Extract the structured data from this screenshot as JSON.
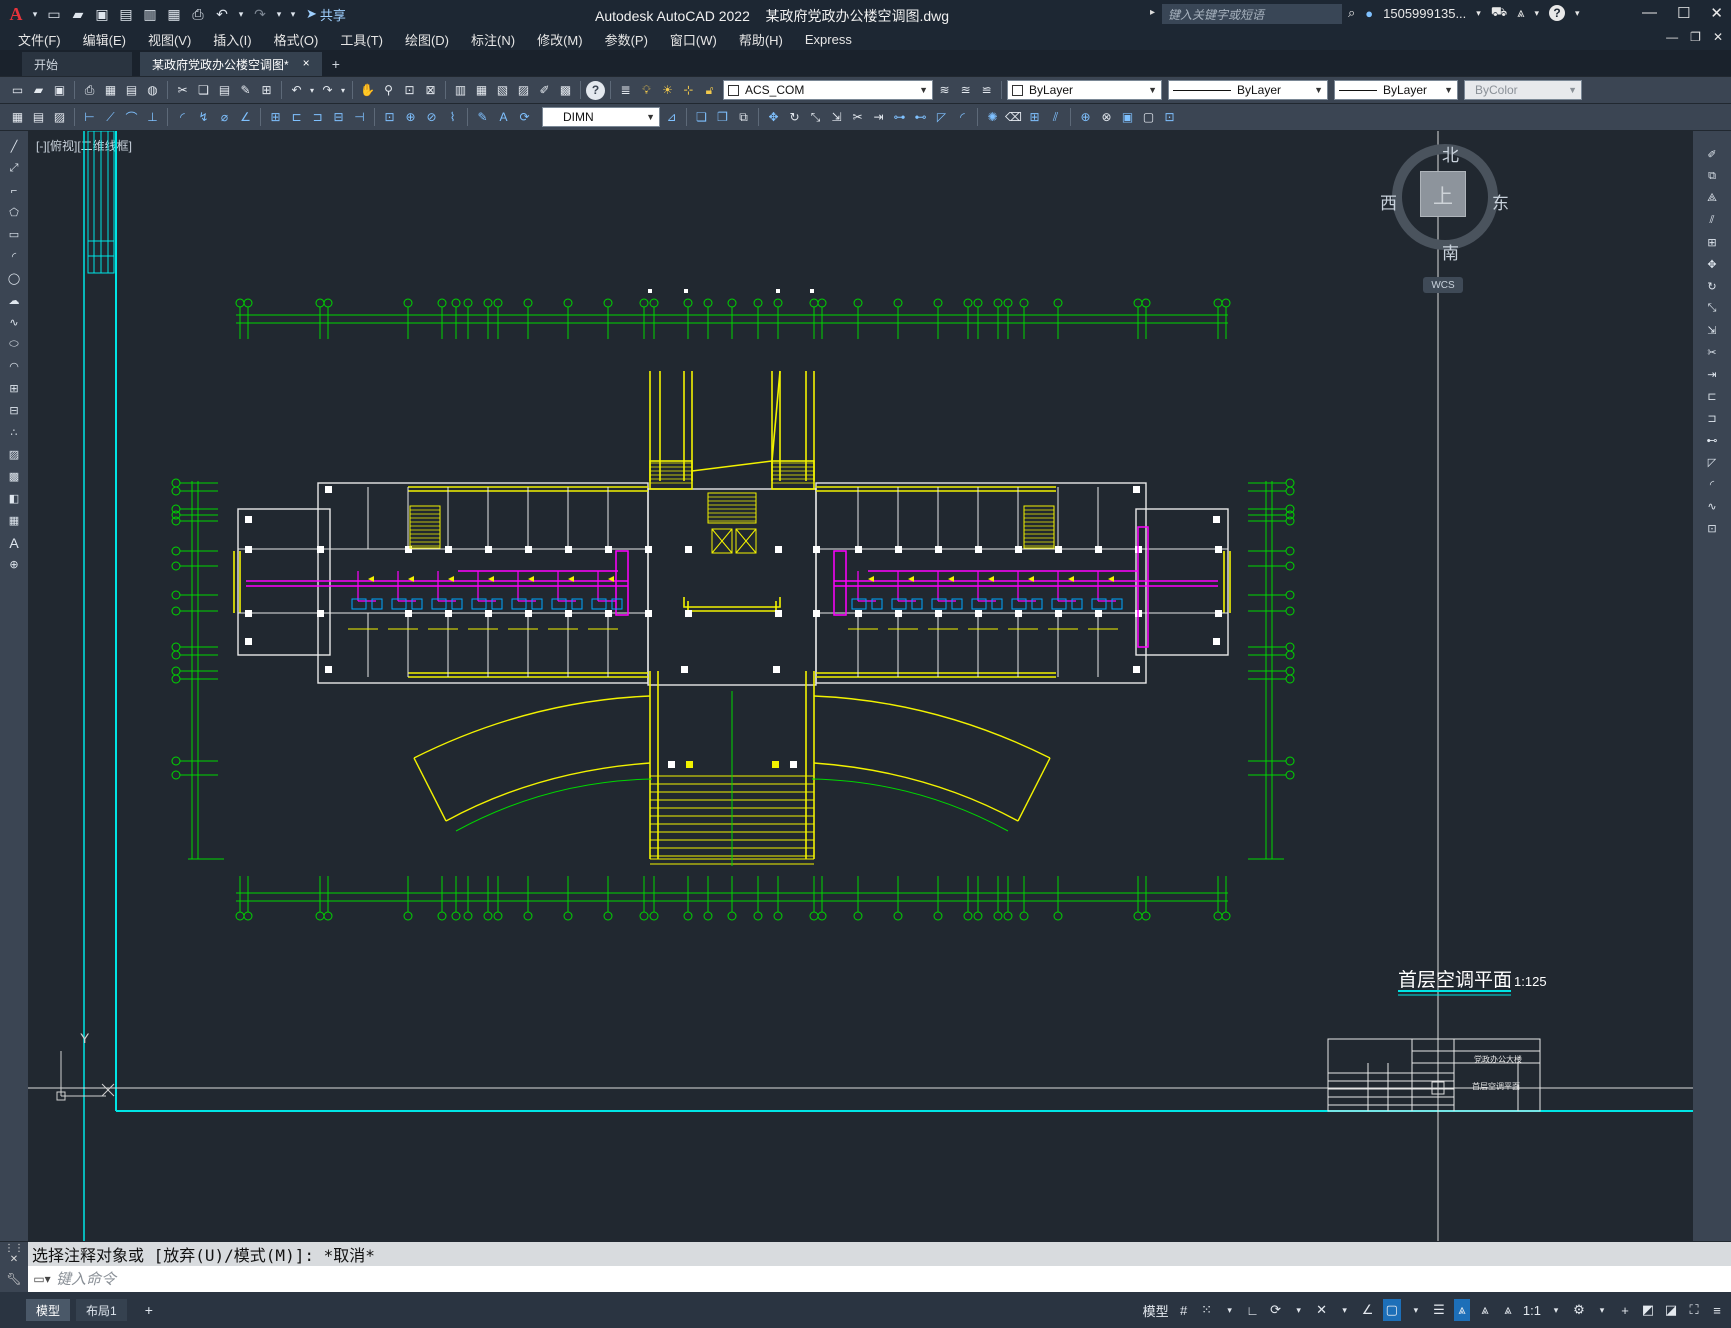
{
  "titlebar": {
    "app_name": "Autodesk AutoCAD 2022",
    "file_name": "某政府党政办公楼空调图.dwg",
    "share_label": "共享",
    "search_placeholder": "键入关键字或短语",
    "user": "1505999135...",
    "help_label": "?"
  },
  "menu": {
    "items": [
      "文件(F)",
      "编辑(E)",
      "视图(V)",
      "插入(I)",
      "格式(O)",
      "工具(T)",
      "绘图(D)",
      "标注(N)",
      "修改(M)",
      "参数(P)",
      "窗口(W)",
      "帮助(H)",
      "Express"
    ]
  },
  "tabs": {
    "start": "开始",
    "active": "某政府党政办公楼空调图*",
    "close": "×",
    "add": "+"
  },
  "toolbar": {
    "layer": "ACS_COM",
    "color": "ByLayer",
    "linetype": "ByLayer",
    "lineweight": "ByLayer",
    "plotstyle": "ByColor",
    "dimstyle": "DIMN"
  },
  "canvas": {
    "view_label": "[-][俯视][二维线框]",
    "viewcube": {
      "north": "北",
      "south": "南",
      "east": "东",
      "west": "西",
      "face": "上",
      "wcs": "WCS"
    },
    "plan_title": "首层空调平面",
    "plan_scale": "1:125",
    "ucs_y": "Y"
  },
  "titleblock": {
    "project": "党政办公大楼",
    "drawing": "首层空调平面"
  },
  "command": {
    "history": "选择注释对象或 [放弃(U)/模式(M)]: *取消*",
    "placeholder": "键入命令"
  },
  "statusbar": {
    "model_tab": "模型",
    "layout_tab": "布局1",
    "add": "+",
    "model_space": "模型",
    "scale": "1:1"
  },
  "colors": {
    "canvas_bg": "#212830",
    "grid_green": "#00d600",
    "wall_yellow": "#f2f200",
    "duct_magenta": "#ff00ff",
    "cyan": "#00ffff"
  }
}
